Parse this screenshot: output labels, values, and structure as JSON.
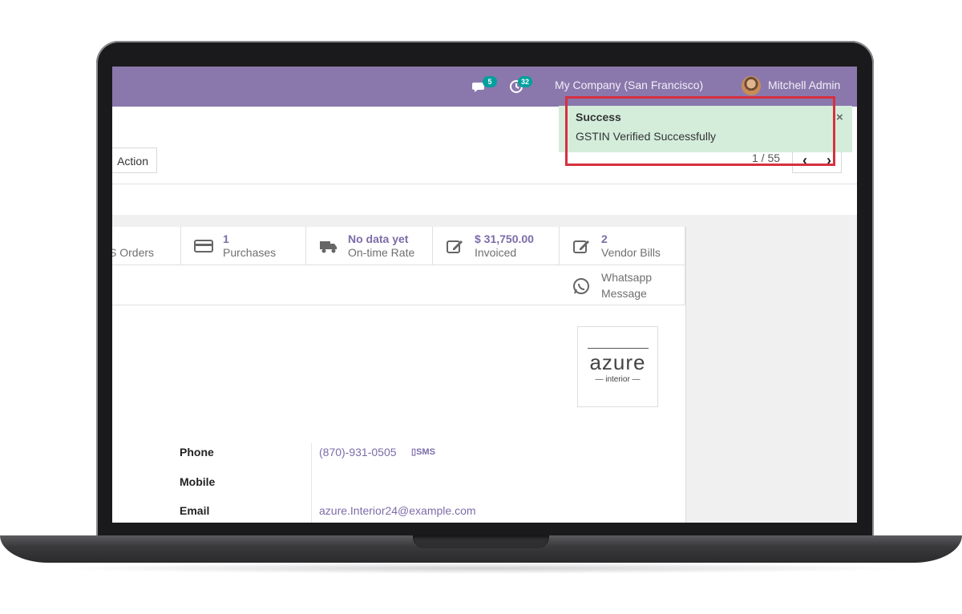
{
  "navbar": {
    "chat_count": "5",
    "activity_count": "32",
    "company": "My Company (San Francisco)",
    "user": "Mitchell Admin"
  },
  "control": {
    "action_label": "Action",
    "pager": "1 / 55",
    "prev": "‹",
    "next": "›"
  },
  "smart_buttons": {
    "orders": {
      "label": "S Orders"
    },
    "purchases": {
      "value": "1",
      "label": "Purchases"
    },
    "ontime": {
      "value": "No data yet",
      "label": "On-time Rate"
    },
    "invoiced": {
      "value": "$ 31,750.00",
      "label": "Invoiced"
    },
    "vendor_bills": {
      "value": "2",
      "label": "Vendor Bills"
    },
    "whatsapp": {
      "line1": "Whatsapp",
      "line2": "Message"
    }
  },
  "logo": {
    "main": "azure",
    "sub": "— interior —"
  },
  "fields": {
    "phone_label": "Phone",
    "phone_value": "(870)-931-0505",
    "sms_label": "SMS",
    "mobile_label": "Mobile",
    "email_label": "Email",
    "email_value": "azure.Interior24@example.com"
  },
  "notification": {
    "title": "Success",
    "message": "GSTIN Verified Successfully",
    "close": "×",
    "highlight_color": "#d6303f"
  },
  "colors": {
    "navbar": "#8a78ac",
    "accent": "#7c6ca8",
    "success_bg": "#d4eddb"
  }
}
